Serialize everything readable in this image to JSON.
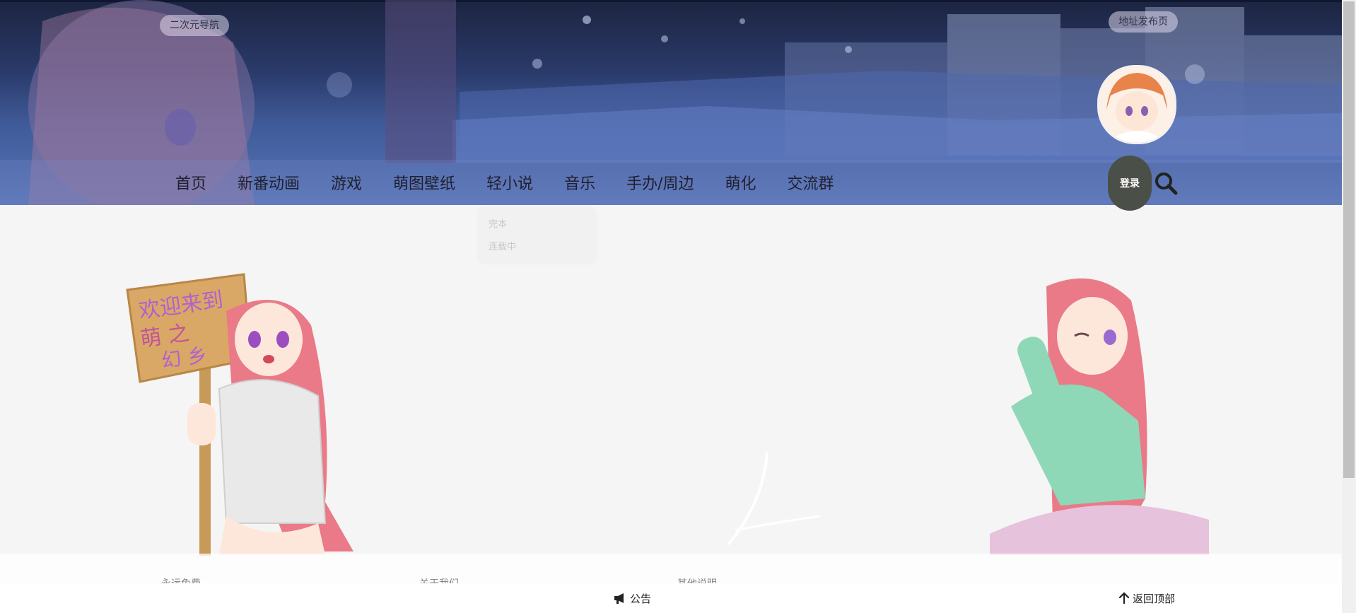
{
  "header": {
    "left_pill": "二次元导航",
    "right_pill": "地址发布页"
  },
  "nav": {
    "items": [
      "首页",
      "新番动画",
      "游戏",
      "萌图壁纸",
      "轻小说",
      "音乐",
      "手办/周边",
      "萌化",
      "交流群"
    ],
    "login_label": "登录",
    "search_icon": "search-icon"
  },
  "dropdown": {
    "items": [
      "完本",
      "连载中"
    ]
  },
  "bottom_bar": {
    "notice_label": "公告",
    "notice_icon": "megaphone-icon",
    "back_top_label": "返回顶部",
    "back_top_icon": "arrow-up-icon"
  },
  "footer": {
    "col1_title": "永远免费",
    "col2_title": "关于我们",
    "col3_title": "其他说明"
  },
  "colors": {
    "login_bg": "#4a5048",
    "page_bg": "#f5f5f5"
  }
}
